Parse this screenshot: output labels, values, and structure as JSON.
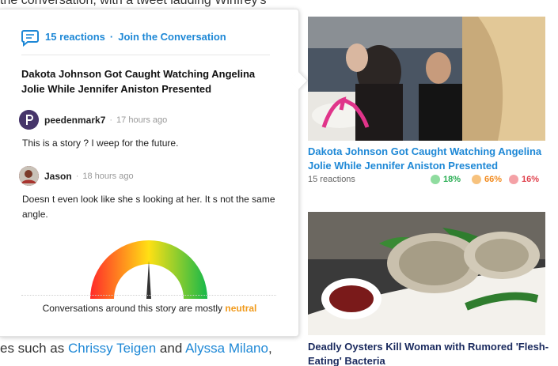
{
  "background": {
    "top_line_prefix": "the conversation, with a tweet lauding Winfrey's",
    "bottom_prefix": "es such as ",
    "bottom_link1": "Chrissy Teigen",
    "bottom_mid": " and ",
    "bottom_link2": "Alyssa Milano",
    "bottom_suffix": ","
  },
  "popover": {
    "reactions_label": "15 reactions",
    "separator": "·",
    "join_label": "Join the Conversation",
    "title": "Dakota Johnson Got Caught Watching Angelina Jolie While Jennifer Aniston Presented",
    "comments": [
      {
        "user": "peedenmark7",
        "time": "17 hours ago",
        "text": "This is a story ? I weep for the future."
      },
      {
        "user": "Jason",
        "time": "18 hours ago",
        "text": "Doesn t even look like she s looking at her. It s not the same angle."
      }
    ],
    "gauge": {
      "caption_prefix": "Conversations around this story are mostly ",
      "caption_value": "neutral",
      "level": 0.5,
      "colors": {
        "low": "#ff2a2a",
        "mid": "#ffe014",
        "high": "#16b84a"
      }
    }
  },
  "cards": [
    {
      "title": "Dakota Johnson Got Caught Watching Angelina Jolie While Jennifer Aniston Presented",
      "reactions": "15 reactions",
      "positive": "18%",
      "neutral": "66%",
      "negative": "16%"
    },
    {
      "title": "Deadly Oysters Kill Woman with Rumored 'Flesh-Eating' Bacteria"
    }
  ],
  "colors": {
    "link": "#1e88d6",
    "neutral": "#f19a1b",
    "dark_title": "#1a2a5e"
  }
}
